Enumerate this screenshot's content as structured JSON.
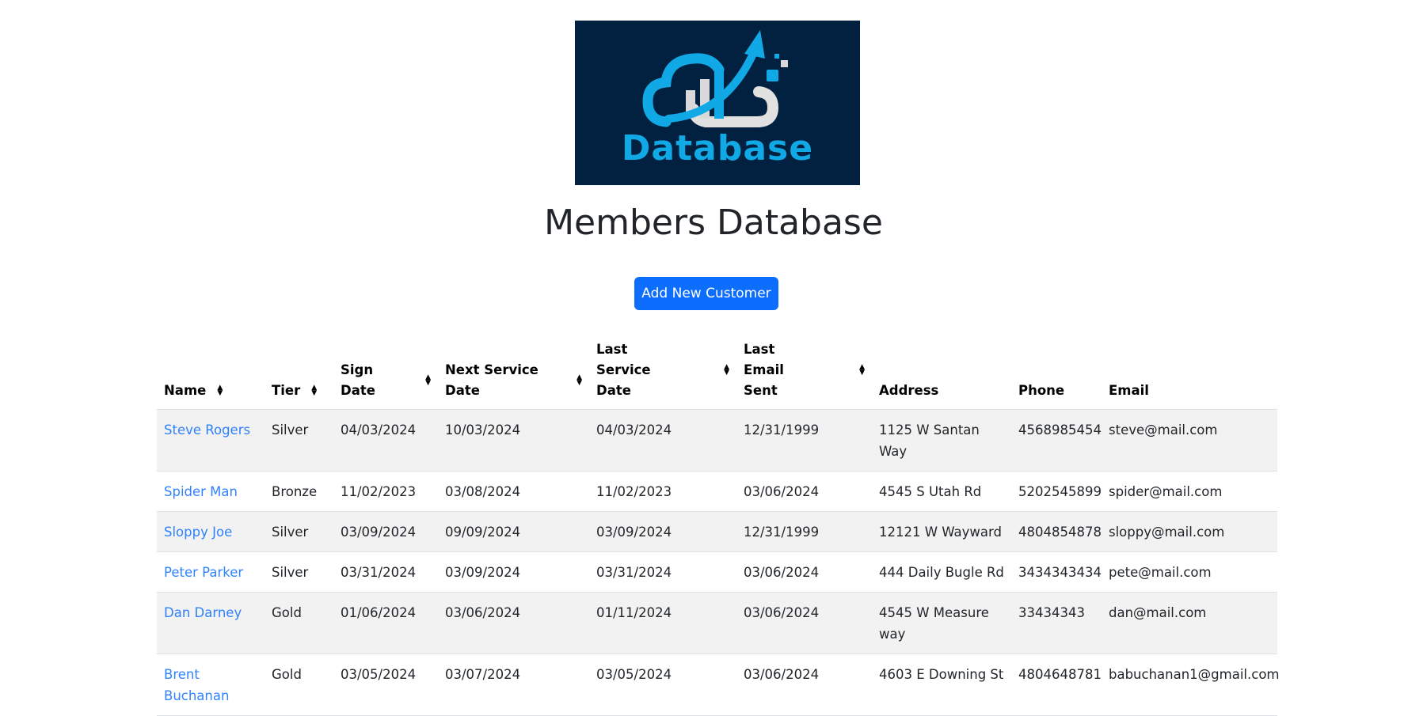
{
  "logo": {
    "text": "Database",
    "brand_color": "#11a8e6",
    "bg_color": "#02203f"
  },
  "page_title": "Members Database",
  "add_button_label": "Add New Customer",
  "table": {
    "headers": {
      "name": "Name",
      "tier": "Tier",
      "sign_date": "Sign Date",
      "next_service": "Next Service Date",
      "last_service": "Last Service Date",
      "last_email": "Last Email Sent",
      "address": "Address",
      "phone": "Phone",
      "email": "Email"
    },
    "rows": [
      {
        "name": "Steve Rogers",
        "tier": "Silver",
        "sign_date": "04/03/2024",
        "next_service": "10/03/2024",
        "last_service": "04/03/2024",
        "last_email": "12/31/1999",
        "address": "1125 W Santan Way",
        "phone": "4568985454",
        "email": "steve@mail.com"
      },
      {
        "name": "Spider Man",
        "tier": "Bronze",
        "sign_date": "11/02/2023",
        "next_service": "03/08/2024",
        "last_service": "11/02/2023",
        "last_email": "03/06/2024",
        "address": "4545 S Utah Rd",
        "phone": "5202545899",
        "email": "spider@mail.com"
      },
      {
        "name": "Sloppy Joe",
        "tier": "Silver",
        "sign_date": "03/09/2024",
        "next_service": "09/09/2024",
        "last_service": "03/09/2024",
        "last_email": "12/31/1999",
        "address": "12121 W Wayward",
        "phone": "4804854878",
        "email": "sloppy@mail.com"
      },
      {
        "name": "Peter Parker",
        "tier": "Silver",
        "sign_date": "03/31/2024",
        "next_service": "03/09/2024",
        "last_service": "03/31/2024",
        "last_email": "03/06/2024",
        "address": "444 Daily Bugle Rd",
        "phone": "3434343434",
        "email": "pete@mail.com"
      },
      {
        "name": "Dan Darney",
        "tier": "Gold",
        "sign_date": "01/06/2024",
        "next_service": "03/06/2024",
        "last_service": "01/11/2024",
        "last_email": "03/06/2024",
        "address": "4545 W Measure way",
        "phone": "33434343",
        "email": "dan@mail.com"
      },
      {
        "name": "Brent Buchanan",
        "tier": "Gold",
        "sign_date": "03/05/2024",
        "next_service": "03/07/2024",
        "last_service": "03/05/2024",
        "last_email": "03/06/2024",
        "address": "4603 E Downing St",
        "phone": "4804648781",
        "email": "babuchanan1@gmail.com"
      }
    ]
  }
}
